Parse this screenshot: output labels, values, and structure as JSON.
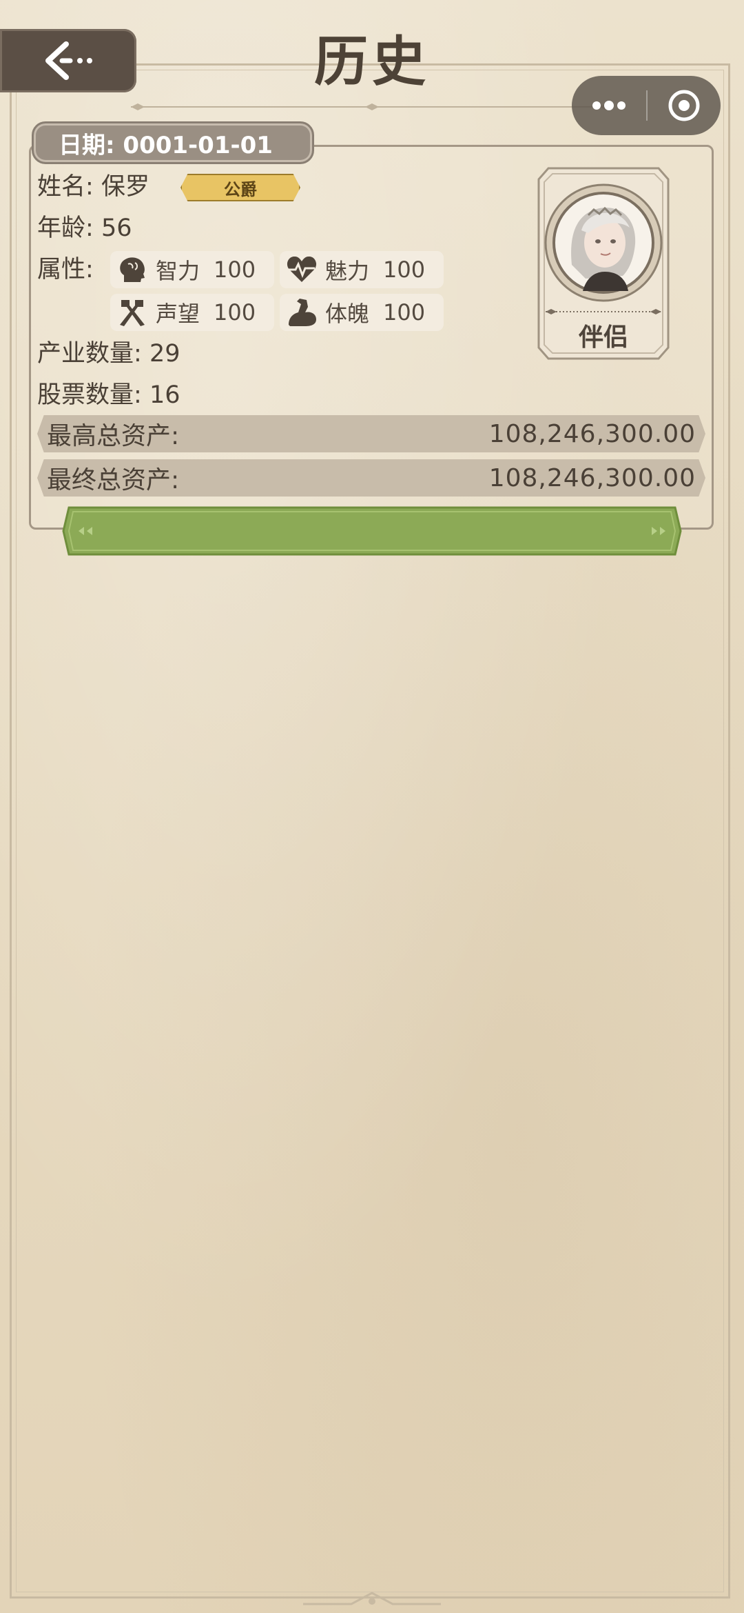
{
  "header": {
    "title": "历史"
  },
  "record": {
    "date": "日期: 0001-01-01",
    "name_label": "姓名:",
    "name_value": "保罗",
    "title_badge": "公爵",
    "age_label": "年龄:",
    "age_value": "56",
    "attributes_label": "属性:",
    "attributes": [
      {
        "icon": "brain-icon",
        "label": "智力",
        "value": "100"
      },
      {
        "icon": "heartbeat-icon",
        "label": "魅力",
        "value": "100"
      },
      {
        "icon": "crossed-hammers-icon",
        "label": "声望",
        "value": "100"
      },
      {
        "icon": "flexed-arm-icon",
        "label": "体魄",
        "value": "100"
      }
    ],
    "industry_label": "产业数量:",
    "industry_value": "29",
    "stock_label": "股票数量:",
    "stock_value": "16",
    "max_assets_label": "最高总资产:",
    "max_assets_value": "108,246,300.00",
    "final_assets_label": "最终总资产:",
    "final_assets_value": "108,246,300.00",
    "partner_label": "伴侣"
  },
  "colors": {
    "background": "#e8dcc4",
    "brown_dark": "#5b4f45",
    "badge_gold": "#e8c464",
    "green_bar": "#8caa56"
  }
}
